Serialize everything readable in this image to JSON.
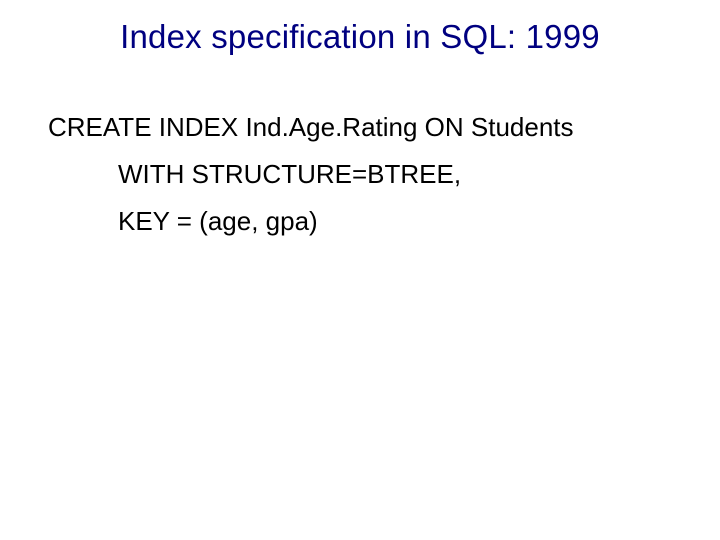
{
  "title": "Index specification in SQL: 1999",
  "code": {
    "line1": "CREATE INDEX Ind.Age.Rating ON Students",
    "line2": "WITH STRUCTURE=BTREE,",
    "line3": "KEY = (age, gpa)"
  }
}
